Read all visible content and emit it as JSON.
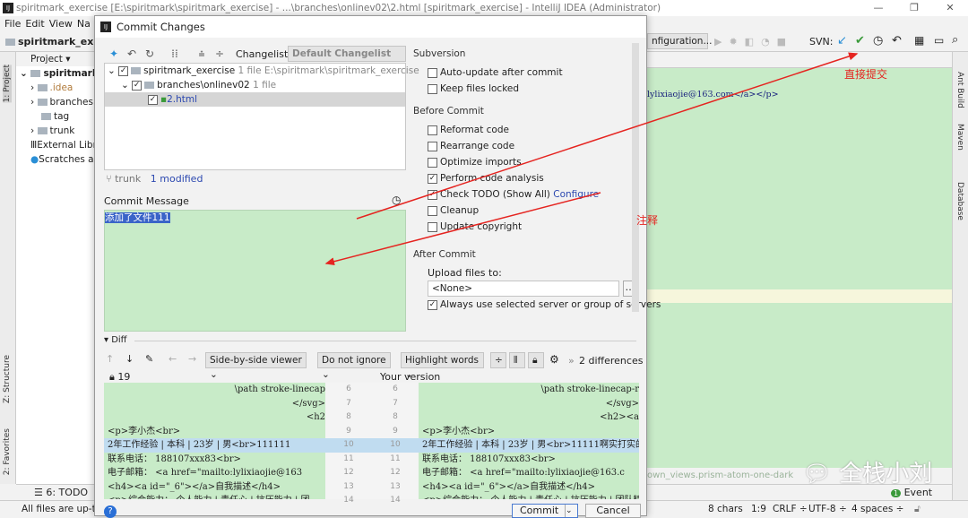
{
  "window": {
    "title": "spiritmark_exercise [E:\\spiritmark\\spiritmark_exercise] - ...\\branches\\onlinev02\\2.html [spiritmark_exercise] - IntelliJ IDEA (Administrator)",
    "app_icon": "IJ"
  },
  "menu": [
    "File",
    "Edit",
    "View",
    "Na"
  ],
  "nav": {
    "project": "spiritmark_exerc",
    "run_config": "nfiguration...",
    "svn_label": "SVN:"
  },
  "left_strip": {
    "project": "1: Project",
    "structure": "Z: Structure",
    "favorites": "2: Favorites"
  },
  "project_panel": {
    "header": "Project",
    "items": [
      {
        "label": "spiritmark_",
        "level": 0
      },
      {
        "label": ".idea",
        "level": 1
      },
      {
        "label": "branches",
        "level": 1
      },
      {
        "label": "tag",
        "level": 1
      },
      {
        "label": "trunk",
        "level": 1
      },
      {
        "label": "External Libr",
        "level": 0
      },
      {
        "label": "Scratches a",
        "level": 0
      }
    ]
  },
  "dialog": {
    "title": "Commit Changes",
    "changelist_label": "Changelist:",
    "changelist_value": "Default Changelist",
    "tree": [
      {
        "name": "spiritmark_exercise",
        "count": "1 file",
        "path": "E:\\spiritmark\\spiritmark_exercise"
      },
      {
        "name": "branches\\onlinev02",
        "count": "1 file"
      },
      {
        "name": "2.html"
      }
    ],
    "branch": "trunk",
    "modified": "1 modified",
    "commit_message_label": "Commit Message",
    "commit_message": "添加了文件111",
    "subversion": {
      "title": "Subversion",
      "options": [
        {
          "label": "Auto-update after commit",
          "checked": false
        },
        {
          "label": "Keep files locked",
          "checked": false
        }
      ]
    },
    "before_commit": {
      "title": "Before Commit",
      "options": [
        {
          "label": "Reformat code",
          "checked": false
        },
        {
          "label": "Rearrange code",
          "checked": false
        },
        {
          "label": "Optimize imports",
          "checked": false
        },
        {
          "label": "Perform code analysis",
          "checked": true
        },
        {
          "label": "Check TODO (Show All)",
          "checked": true,
          "link": "Configure"
        },
        {
          "label": "Cleanup",
          "checked": false
        },
        {
          "label": "Update copyright",
          "checked": false
        }
      ]
    },
    "after_commit": {
      "title": "After Commit",
      "upload_label": "Upload files to:",
      "upload_value": "<None>",
      "always_use": "Always use selected server or group of servers",
      "always_checked": true
    },
    "diff": {
      "title": "Diff",
      "viewer": "Side-by-side viewer",
      "ignore": "Do not ignore",
      "highlight": "Highlight words",
      "differences": "2 differences",
      "left_header": "19",
      "right_header": "Your version",
      "line_numbers": [
        "6",
        "7",
        "8",
        "9",
        "10",
        "11",
        "12",
        "13",
        "14"
      ],
      "left_lines": [
        "\\path stroke-linecap",
        "</svg>",
        "<h2",
        "<p>李小杰<br>",
        "2年工作经验 | 本科 | 23岁 | 男<br>111111",
        "联系电话： 188107xxx83<br>",
        "电子邮箱： <a href=\"mailto:lylixiaojie@163",
        "<h4><a id=\"_6\"></a>自我描述</h4>",
        "<p>综合能力： 个人能力 | 责任心 | 抗压能力 | 团"
      ],
      "right_lines": [
        "\\path stroke-linecap-r",
        "</svg>",
        "<h2><a",
        "<p>李小杰<br>",
        "2年工作经验 | 本科 | 23岁 | 男<br>11111啊实打实的",
        "联系电话： 188107xxx83<br>",
        "电子邮箱： <a href=\"mailto:lylixiaojie@163.c",
        "<h4><a id=\"_6\"></a>自我描述</h4>",
        "<p>综合能力： 个人能力 | 责任心 | 抗压能力 | 团队精"
      ]
    },
    "commit_button": "Commit",
    "cancel_button": "Cancel",
    "help": "?"
  },
  "editor": {
    "line": "lylixiaojie@163.com</a></p>",
    "breadcrumb": "own_views.prism-atom-one-dark"
  },
  "right_strip": [
    "Ant Build",
    "Maven",
    "Database"
  ],
  "bottom": {
    "todo": "6: TODO",
    "event_log": "Event Log",
    "event_count": "1"
  },
  "status": {
    "left": "All files are up-to",
    "chars": "8 chars",
    "pos": "1:9",
    "crlf": "CRLF ÷",
    "encoding": "UTF-8 ÷",
    "indent": "4 spaces ÷"
  },
  "annotations": {
    "commit_direct": "直接提交",
    "comment": "注释",
    "color": "#e52420"
  },
  "watermark": "全栈小刘"
}
